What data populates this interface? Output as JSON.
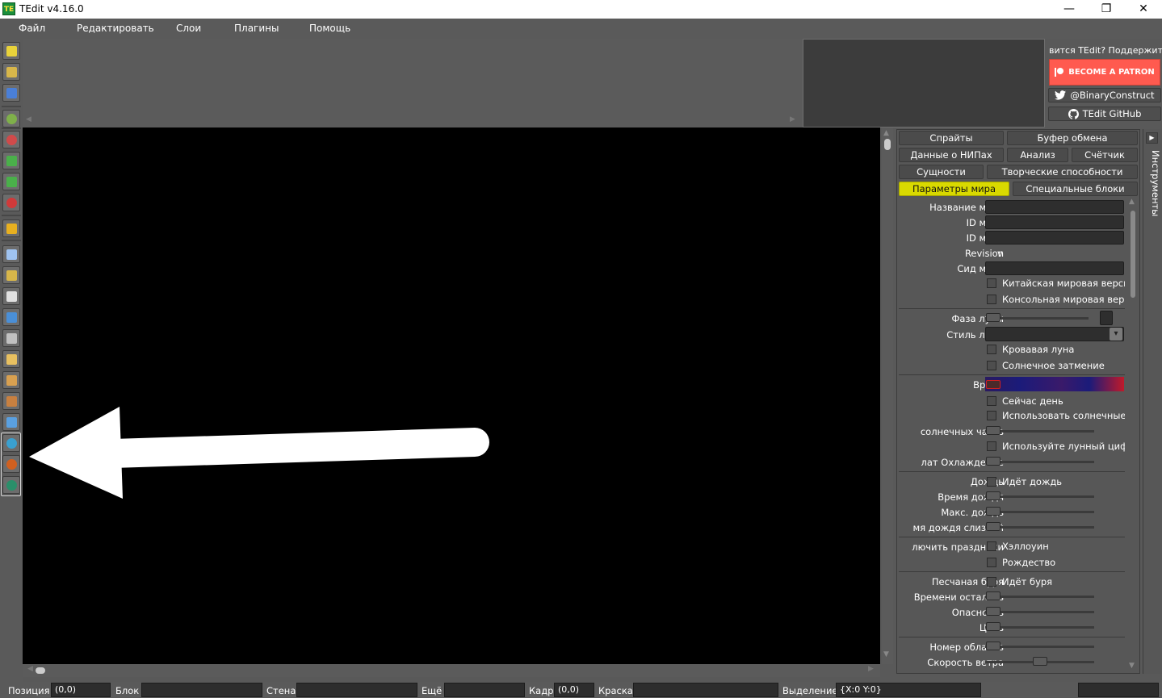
{
  "window": {
    "title": "TEdit v4.16.0",
    "icon_text": "TE",
    "controls": [
      "minimize-icon",
      "restore-icon",
      "close-icon"
    ]
  },
  "menu": [
    "Файл",
    "Редактировать",
    "Слои",
    "Плагины",
    "Помощь"
  ],
  "toolbar_icons": [
    {
      "name": "new-world-icon",
      "color": "#e8d23a"
    },
    {
      "name": "open-icon",
      "color": "#d7b64a"
    },
    {
      "name": "save-icon",
      "color": "#4a7fd7"
    },
    {
      "name": "zoom-in-icon",
      "color": "#7fb04a"
    },
    {
      "name": "zoom-out-icon",
      "color": "#d04a4a"
    },
    {
      "name": "undo-icon",
      "color": "#4ab04a"
    },
    {
      "name": "redo-icon",
      "color": "#4ab04a"
    },
    {
      "name": "delete-icon",
      "color": "#d03a3a"
    },
    {
      "name": "crop-icon",
      "color": "#e8b020"
    },
    {
      "name": "copy-icon",
      "color": "#9fc3f0"
    },
    {
      "name": "paste-icon",
      "color": "#d7b64a"
    },
    {
      "name": "arrow-select-icon",
      "color": "#e0e0e0"
    },
    {
      "name": "selection-icon",
      "color": "#4a8fd7"
    },
    {
      "name": "picker-icon",
      "color": "#c0c0c0"
    },
    {
      "name": "pencil-icon",
      "color": "#e8c060"
    },
    {
      "name": "brush-icon",
      "color": "#d8a050"
    },
    {
      "name": "hammer-icon",
      "color": "#c88040"
    },
    {
      "name": "fill-icon",
      "color": "#5aa0e0"
    },
    {
      "name": "world-icon",
      "color": "#3aa0d0"
    },
    {
      "name": "sprite-icon",
      "color": "#d06020"
    },
    {
      "name": "globe-icon",
      "color": "#2a8f6a"
    }
  ],
  "support": {
    "text": "вится TEdit? Поддержите",
    "patron_label": "BECOME A PATRON",
    "twitter_label": "@BinaryConstruct",
    "github_label": "TEdit GitHub"
  },
  "tabs": {
    "row1": [
      "Спрайты",
      "Буфер обмена"
    ],
    "row2": [
      "Данные о НИПах",
      "Анализ",
      "Счётчик"
    ],
    "row3": [
      "Сущности",
      "Творческие способности"
    ],
    "row4": [
      "Параметры мира",
      "Специальные блоки"
    ],
    "active": "Параметры мира"
  },
  "world": {
    "name_label": "Название мира",
    "id_label": "ID мира",
    "id2_label": "ID мира",
    "revision_label": "Revision",
    "revision_value": "v",
    "seed_label": "Сид мира",
    "chinese_label": "Китайская мировая версия",
    "console_label": "Консольная мировая версия",
    "moon_phase_label": "Фаза луны",
    "moon_style_label": "Стиль луны",
    "blood_moon_label": "Кровавая луна",
    "eclipse_label": "Солнечное затмение",
    "time_label": "Время",
    "daytime_label": "Сейчас день",
    "use_sundial_label": "Использовать солнечные часы",
    "sundial_label": "солнечных часов",
    "moondial_label": "Используйте лунный циферблат",
    "cloud_cooldown_label": "облат Охлаждение",
    "rain_label": "Дождь",
    "raining_label": "Идёт дождь",
    "rain_time_label": "Время дождя",
    "max_rain_label": "Макс. дождь",
    "slime_rain_label": "мя дождя слизней",
    "holidays_label": "лючить праздники",
    "halloween_label": "Хэллоуин",
    "christmas_label": "Рождество",
    "sandstorm_label": "Песчаная буря",
    "storm_label": "Идёт буря",
    "time_left_label": "Времени осталось",
    "severity_label": "Опасность",
    "target_label": "Цель",
    "clouds_label": "Номер облаков",
    "wind_label": "Скорость ветра"
  },
  "side_tab": "Инструменты",
  "status": {
    "position_label": "Позиция",
    "position_value": "(0,0)",
    "block_label": "Блок",
    "block_value": "",
    "wall_label": "Стена",
    "wall_value": "",
    "more_label": "Ещё",
    "more_value": "",
    "frame_label": "Кадр",
    "frame_value": "(0,0)",
    "paint_label": "Краска",
    "paint_value": "",
    "selection_label": "Выделение",
    "selection_value": "{X:0 Y:0}"
  },
  "colors": {
    "accent": "#d9d900",
    "patron": "#ff5a4f",
    "canvas": "#000000"
  }
}
